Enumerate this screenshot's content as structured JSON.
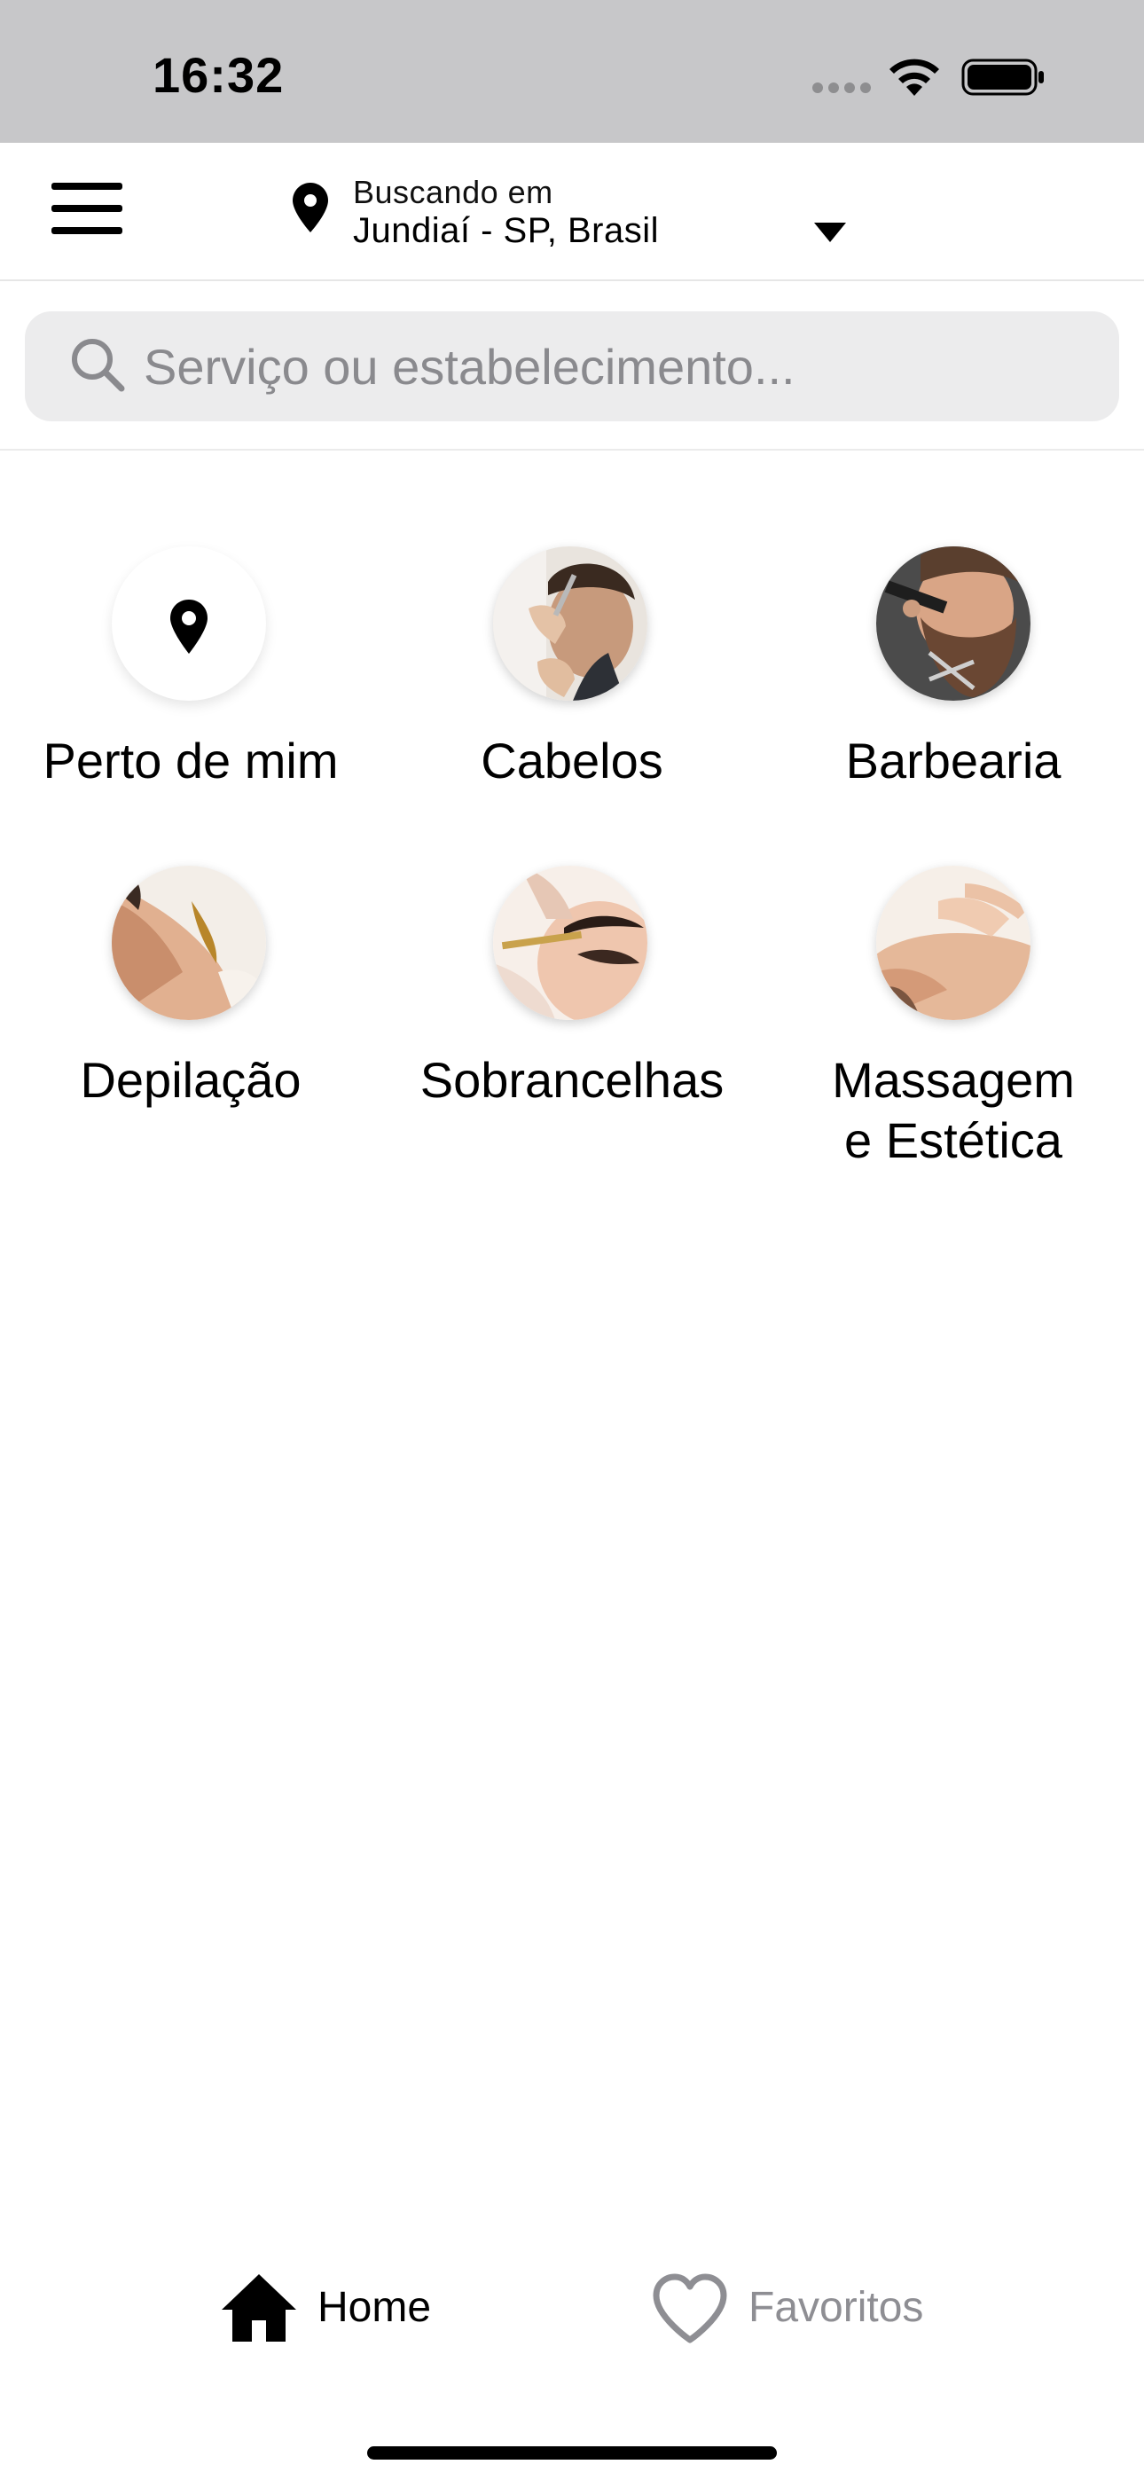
{
  "status_bar": {
    "time": "16:32"
  },
  "header": {
    "location_caption": "Buscando em",
    "location_city": "Jundiaí - SP, Brasil",
    "icons": [
      "menu-icon",
      "location-pin-icon",
      "chevron-down-icon"
    ]
  },
  "search": {
    "placeholder": "Serviço ou estabelecimento..."
  },
  "categories": [
    {
      "label": "Perto de mim",
      "icon": "location-pin-icon"
    },
    {
      "label": "Cabelos",
      "image": "haircut photo"
    },
    {
      "label": "Barbearia",
      "image": "beard trim photo"
    },
    {
      "label": "Depilação",
      "image": "waxing photo"
    },
    {
      "label": "Sobrancelhas",
      "image": "eyebrow photo"
    },
    {
      "label": "Massagem e Estética",
      "line1": "Massagem",
      "line2": "e Estética",
      "image": "massage photo"
    }
  ],
  "tabbar": {
    "home_label": "Home",
    "favorites_label": "Favoritos",
    "active_color": "#000000",
    "inactive_color": "#8e8e93"
  }
}
